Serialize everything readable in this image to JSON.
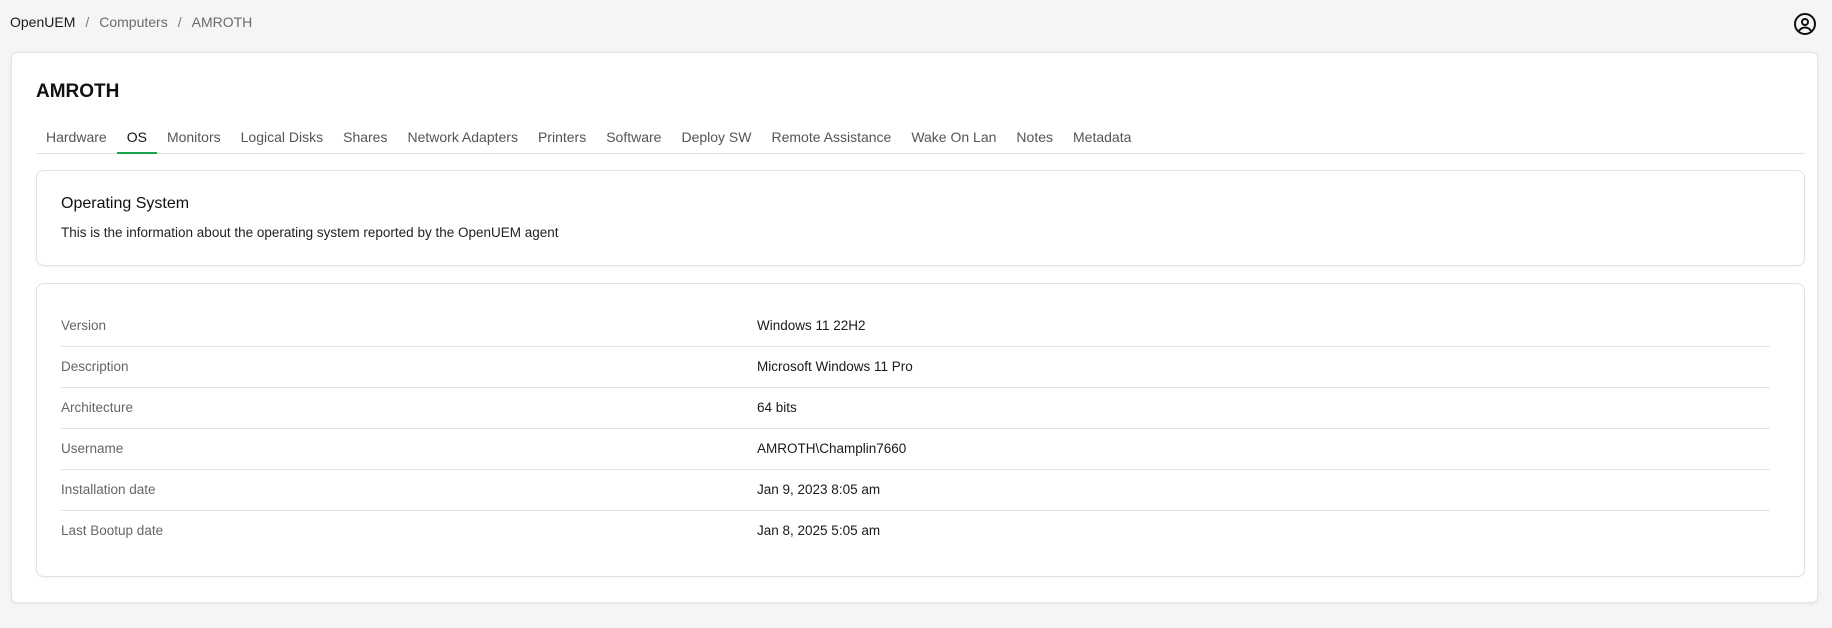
{
  "breadcrumb": {
    "home": "OpenUEM",
    "computers": "Computers",
    "current": "AMROTH",
    "separator": "/"
  },
  "header": {
    "user_icon": "user-circle-icon"
  },
  "page": {
    "title": "AMROTH"
  },
  "tabs": [
    {
      "label": "Hardware",
      "active": false
    },
    {
      "label": "OS",
      "active": true
    },
    {
      "label": "Monitors",
      "active": false
    },
    {
      "label": "Logical Disks",
      "active": false
    },
    {
      "label": "Shares",
      "active": false
    },
    {
      "label": "Network Adapters",
      "active": false
    },
    {
      "label": "Printers",
      "active": false
    },
    {
      "label": "Software",
      "active": false
    },
    {
      "label": "Deploy SW",
      "active": false
    },
    {
      "label": "Remote Assistance",
      "active": false
    },
    {
      "label": "Wake On Lan",
      "active": false
    },
    {
      "label": "Notes",
      "active": false
    },
    {
      "label": "Metadata",
      "active": false
    }
  ],
  "info": {
    "title": "Operating System",
    "description": "This is the information about the operating system reported by the OpenUEM agent"
  },
  "details": [
    {
      "label": "Version",
      "value": "Windows 11 22H2"
    },
    {
      "label": "Description",
      "value": "Microsoft Windows 11 Pro"
    },
    {
      "label": "Architecture",
      "value": "64 bits"
    },
    {
      "label": "Username",
      "value": "AMROTH\\Champlin7660"
    },
    {
      "label": "Installation date",
      "value": "Jan 9, 2023 8:05 am"
    },
    {
      "label": "Last Bootup date",
      "value": "Jan 8, 2025 5:05 am"
    }
  ],
  "colors": {
    "active_tab_underline": "#16a34a",
    "background": "#f5f5f5"
  }
}
